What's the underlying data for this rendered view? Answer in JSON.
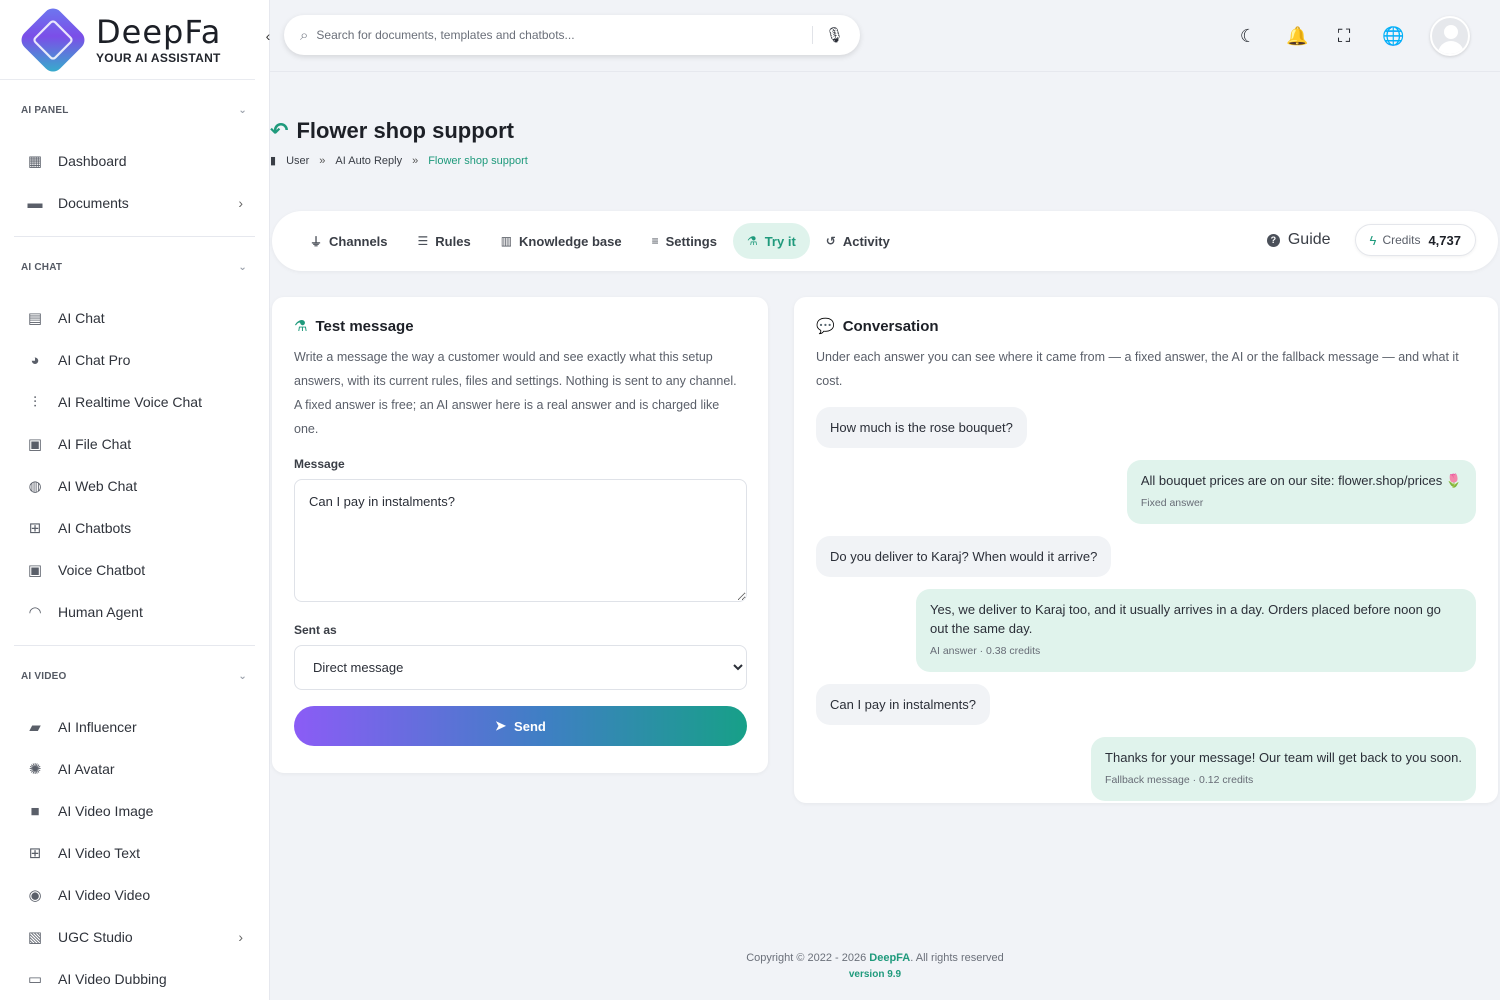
{
  "brand": {
    "name": "DeepFa",
    "tagline": "YOUR AI ASSISTANT"
  },
  "sidebar": {
    "sections": [
      {
        "title": "AI PANEL",
        "items": [
          {
            "label": "Dashboard",
            "icon": "dashboard-icon",
            "glyph": "▦",
            "has_submenu": false
          },
          {
            "label": "Documents",
            "icon": "folder-icon",
            "glyph": "▬",
            "has_submenu": true
          }
        ]
      },
      {
        "title": "AI CHAT",
        "items": [
          {
            "label": "AI Chat",
            "icon": "chat-icon",
            "glyph": "▤",
            "has_submenu": false
          },
          {
            "label": "AI Chat Pro",
            "icon": "comments-icon",
            "glyph": "◕",
            "has_submenu": false
          },
          {
            "label": "AI Realtime Voice Chat",
            "icon": "waveform-icon",
            "glyph": "⫶",
            "has_submenu": false
          },
          {
            "label": "AI File Chat",
            "icon": "file-chat-icon",
            "glyph": "▣",
            "has_submenu": false
          },
          {
            "label": "AI Web Chat",
            "icon": "globe-icon",
            "glyph": "◍",
            "has_submenu": false
          },
          {
            "label": "AI Chatbots",
            "icon": "robot-icon",
            "glyph": "⊞",
            "has_submenu": false
          },
          {
            "label": "Voice Chatbot",
            "icon": "voice-bot-icon",
            "glyph": "▣",
            "has_submenu": false
          },
          {
            "label": "Human Agent",
            "icon": "headset-icon",
            "glyph": "◠",
            "has_submenu": false
          }
        ]
      },
      {
        "title": "AI VIDEO",
        "items": [
          {
            "label": "AI Influencer",
            "icon": "video-camera-icon",
            "glyph": "▰",
            "has_submenu": false
          },
          {
            "label": "AI Avatar",
            "icon": "avatar-icon",
            "glyph": "✺",
            "has_submenu": false
          },
          {
            "label": "AI Video Image",
            "icon": "video-icon",
            "glyph": "■",
            "has_submenu": false
          },
          {
            "label": "AI Video Text",
            "icon": "video-plus-icon",
            "glyph": "⊞",
            "has_submenu": false
          },
          {
            "label": "AI Video Video",
            "icon": "film-camera-icon",
            "glyph": "◉",
            "has_submenu": false
          },
          {
            "label": "UGC Studio",
            "icon": "clapperboard-icon",
            "glyph": "▧",
            "has_submenu": true
          },
          {
            "label": "AI Video Dubbing",
            "icon": "dubbing-icon",
            "glyph": "▭",
            "has_submenu": false
          }
        ]
      }
    ]
  },
  "search": {
    "placeholder": "Search for documents, templates and chatbots..."
  },
  "page": {
    "title": "Flower shop support",
    "breadcrumb": [
      "User",
      "AI Auto Reply",
      "Flower shop support"
    ]
  },
  "tabs": [
    {
      "label": "Channels",
      "icon": "plug-icon",
      "glyph": "⏚",
      "active": false
    },
    {
      "label": "Rules",
      "icon": "list-check-icon",
      "glyph": "☰",
      "active": false
    },
    {
      "label": "Knowledge base",
      "icon": "book-open-icon",
      "glyph": "▥",
      "active": false
    },
    {
      "label": "Settings",
      "icon": "sliders-icon",
      "glyph": "≡",
      "active": false
    },
    {
      "label": "Try it",
      "icon": "flask-icon",
      "glyph": "⚗",
      "active": true
    },
    {
      "label": "Activity",
      "icon": "history-icon",
      "glyph": "↺",
      "active": false
    }
  ],
  "guide": {
    "label": "Guide"
  },
  "credits": {
    "label": "Credits",
    "value": "4,737"
  },
  "test_card": {
    "title": "Test message",
    "description": "Write a message the way a customer would and see exactly what this setup answers, with its current rules, files and settings. Nothing is sent to any channel. A fixed answer is free; an AI answer here is a real answer and is charged like one.",
    "message_label": "Message",
    "message_value": "Can I pay in instalments?",
    "sent_as_label": "Sent as",
    "sent_as_value": "Direct message",
    "send_label": "Send"
  },
  "conversation": {
    "title": "Conversation",
    "description": "Under each answer you can see where it came from — a fixed answer, the AI or the fallback message — and what it cost.",
    "messages": [
      {
        "role": "user",
        "text": "How much is the rose bouquet?",
        "meta": ""
      },
      {
        "role": "bot",
        "text": "All bouquet prices are on our site: flower.shop/prices 🌷",
        "meta": "Fixed answer"
      },
      {
        "role": "user",
        "text": "Do you deliver to Karaj? When would it arrive?",
        "meta": ""
      },
      {
        "role": "bot",
        "text": "Yes, we deliver to Karaj too, and it usually arrives in a day. Orders placed before noon go out the same day.",
        "meta": "AI answer · 0.38 credits"
      },
      {
        "role": "user",
        "text": "Can I pay in instalments?",
        "meta": ""
      },
      {
        "role": "bot",
        "text": "Thanks for your message! Our team will get back to you soon.",
        "meta": "Fallback message · 0.12 credits"
      }
    ]
  },
  "footer": {
    "copyright": "Copyright © 2022 - 2026",
    "brand": "DeepFA",
    "rights": ". All rights reserved",
    "version": "version 9.9"
  },
  "colors": {
    "accent": "#1f9a7c",
    "active_tab_bg": "#dff3ec",
    "bot_bubble": "#e0f3ec",
    "user_bubble": "#f1f3f6"
  }
}
